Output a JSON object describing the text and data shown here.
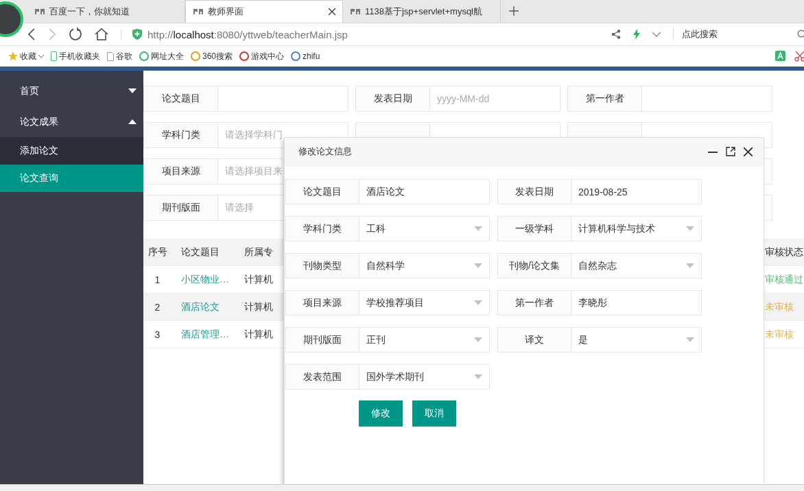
{
  "browser": {
    "tabs": [
      {
        "title": "百度一下，你就知道",
        "selected": false
      },
      {
        "title": "教师界面",
        "selected": true
      },
      {
        "title": "1138基于jsp+servlet+mysql航",
        "selected": false
      }
    ],
    "url": "http://**localhost**:8080/yttweb/teacherMain.jsp",
    "search_placeholder": "点此搜索",
    "bookmarks": [
      "收藏",
      "手机收藏夹",
      "谷歌",
      "网址大全",
      "360搜索",
      "游戏中心",
      "zhifu"
    ]
  },
  "sidebar": {
    "items": [
      {
        "label": "首页",
        "expanded": false
      },
      {
        "label": "论文成果",
        "expanded": true,
        "children": [
          {
            "label": "添加论文",
            "selected": false
          },
          {
            "label": "论文查询",
            "selected": true
          }
        ]
      }
    ]
  },
  "search_form": {
    "rows": [
      [
        {
          "label": "论文题目"
        },
        {
          "label": "发表日期",
          "placeholder": "yyyy-MM-dd"
        },
        {
          "label": "第一作者"
        }
      ],
      [
        {
          "label": "学科门类",
          "placeholder": "请选择学科门"
        }
      ],
      [
        {
          "label": "项目来源",
          "placeholder": "请选择项目来"
        }
      ],
      [
        {
          "label": "期刊版面",
          "placeholder": "请选择"
        }
      ]
    ]
  },
  "table": {
    "columns": [
      "序号",
      "论文题目",
      "所属专"
    ],
    "status_column": "审核状态",
    "rows": [
      {
        "no": "1",
        "title": "小区物业…",
        "major": "计算机",
        "status": "审核通过",
        "color": "#5fb878",
        "selected": false
      },
      {
        "no": "2",
        "title": "酒店论文",
        "major": "计算机",
        "status": "未审核",
        "color": "#e0b74a",
        "selected": true
      },
      {
        "no": "3",
        "title": "酒店管理…",
        "major": "计算机",
        "status": "未审核",
        "color": "#e0b74a",
        "selected": false
      }
    ]
  },
  "dialog": {
    "title": "修改论文信息",
    "rows": [
      [
        {
          "label": "论文题目",
          "value": "酒店论文",
          "kind": "text"
        },
        {
          "label": "发表日期",
          "value": "2019-08-25",
          "kind": "text"
        }
      ],
      [
        {
          "label": "学科门类",
          "value": "工科",
          "kind": "select"
        },
        {
          "label": "一级学科",
          "value": "计算机科学与技术",
          "kind": "select"
        }
      ],
      [
        {
          "label": "刊物类型",
          "value": "自然科学",
          "kind": "select"
        },
        {
          "label": "刊物/论文集",
          "value": "自然杂志",
          "kind": "select"
        }
      ],
      [
        {
          "label": "项目来源",
          "value": "学校推荐项目",
          "kind": "select"
        },
        {
          "label": "第一作者",
          "value": "李晓彤",
          "kind": "text"
        }
      ],
      [
        {
          "label": "期刊版面",
          "value": "正刊",
          "kind": "select"
        },
        {
          "label": "译文",
          "value": "是",
          "kind": "select"
        }
      ],
      [
        {
          "label": "发表范围",
          "value": "国外学术期刊",
          "kind": "select"
        }
      ]
    ],
    "buttons": [
      "修改",
      "取消"
    ]
  }
}
